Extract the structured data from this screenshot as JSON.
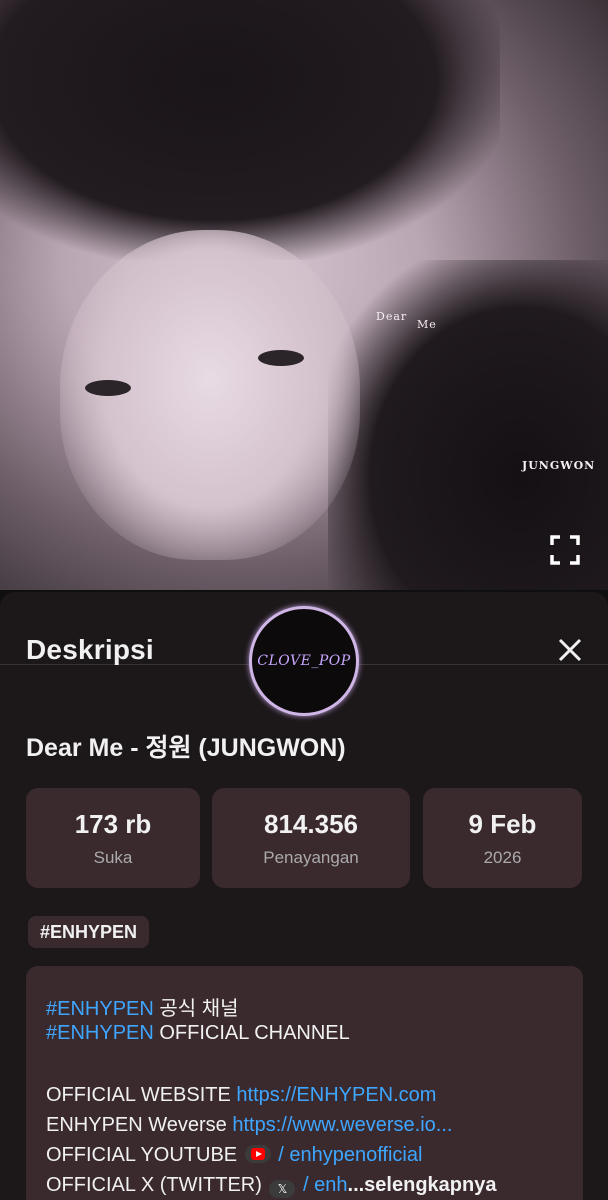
{
  "video": {
    "overlay_dear": "Dear",
    "overlay_me": "Me",
    "overlay_name": "JUNGWON"
  },
  "sheet": {
    "title": "Deskripsi",
    "logo_text": "CLOVE_POP"
  },
  "video_title": "Dear Me - 정원 (JUNGWON)",
  "stats": [
    {
      "value": "173 rb",
      "label": "Suka"
    },
    {
      "value": "814.356",
      "label": "Penayangan"
    },
    {
      "value": "9 Feb",
      "label": "2026"
    }
  ],
  "tag_chip": "#ENHYPEN",
  "description": {
    "line1_tag": "#ENHYPEN",
    "line1_text": " 공식 채널",
    "line2_tag": "#ENHYPEN",
    "line2_text": " OFFICIAL CHANNEL",
    "line3_label": "OFFICIAL WEBSITE ",
    "line3_link": "https://ENHYPEN.com",
    "line4_label": "ENHYPEN Weverse ",
    "line4_link": "https://www.weverse.io...",
    "line5_label": "OFFICIAL YOUTUBE ",
    "line5_link": " / enhypenofficial",
    "line6_label": "OFFICIAL X (TWITTER) ",
    "line6_link": " / enh",
    "more_label": "...selengkapnya"
  },
  "icons": {
    "fullscreen": "fullscreen-icon",
    "close": "close-icon",
    "youtube": "youtube-icon",
    "x": "x-icon"
  },
  "colors": {
    "link": "#3ea6ff",
    "card": "#3a2a2e",
    "sheet": "#1c1719"
  }
}
